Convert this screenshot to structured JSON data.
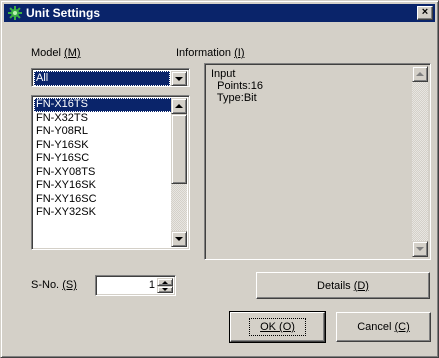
{
  "window": {
    "title": "Unit Settings",
    "close_label": "×",
    "title_color": "#0a246a"
  },
  "model": {
    "label_text": "Model ",
    "label_shortcut": "(M)",
    "selected_value": "All",
    "list_items": [
      "FN-X16TS",
      "FN-X32TS",
      "FN-Y08RL",
      "FN-Y16SK",
      "FN-Y16SC",
      "FN-XY08TS",
      "FN-XY16SK",
      "FN-XY16SC",
      "FN-XY32SK"
    ],
    "selected_index": 0
  },
  "information": {
    "label_text": "Information ",
    "label_shortcut": "(I)",
    "lines": [
      "Input",
      "  Points:16",
      "  Type:Bit"
    ]
  },
  "sno": {
    "label_text": "S-No. ",
    "label_shortcut": "(S)",
    "value": "1"
  },
  "buttons": {
    "details_text": "Details ",
    "details_shortcut": "(D)",
    "ok_text": "OK ",
    "ok_shortcut": "(O)",
    "cancel_text": "Cancel ",
    "cancel_shortcut": "(C)"
  },
  "icons": {
    "app_icon": "gear-star-icon",
    "close": "close-icon",
    "dropdown": "chevron-down-icon",
    "scroll_up": "scroll-up-icon",
    "scroll_down": "scroll-down-icon"
  }
}
